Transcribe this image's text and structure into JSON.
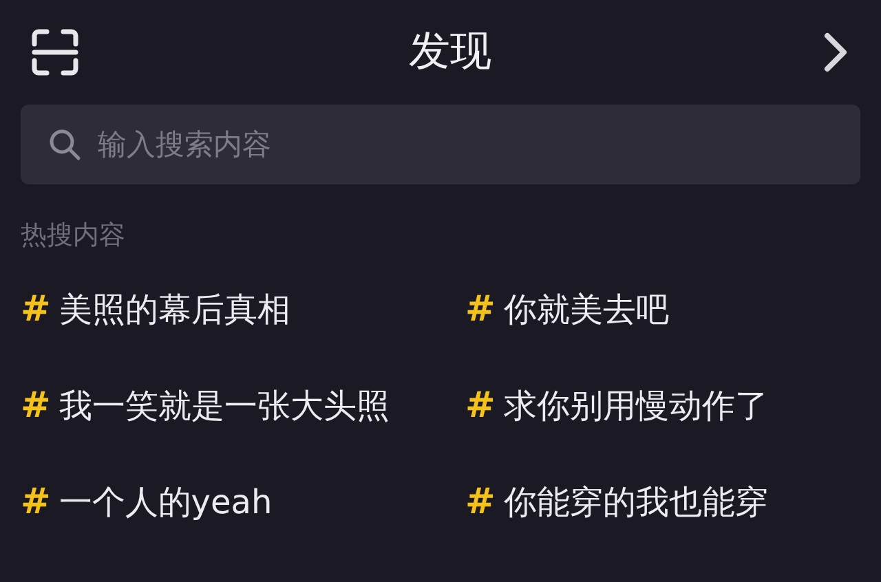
{
  "header": {
    "title": "发现"
  },
  "search": {
    "placeholder": "输入搜索内容"
  },
  "hot_section": {
    "label": "热搜内容",
    "items": [
      {
        "mark": "#",
        "text": "美照的幕后真相"
      },
      {
        "mark": "#",
        "text": "你就美去吧"
      },
      {
        "mark": "#",
        "text": "我一笑就是一张大头照"
      },
      {
        "mark": "#",
        "text": "求你别用慢动作了"
      },
      {
        "mark": "#",
        "text": "一个人的yeah"
      },
      {
        "mark": "#",
        "text": "你能穿的我也能穿"
      }
    ]
  }
}
